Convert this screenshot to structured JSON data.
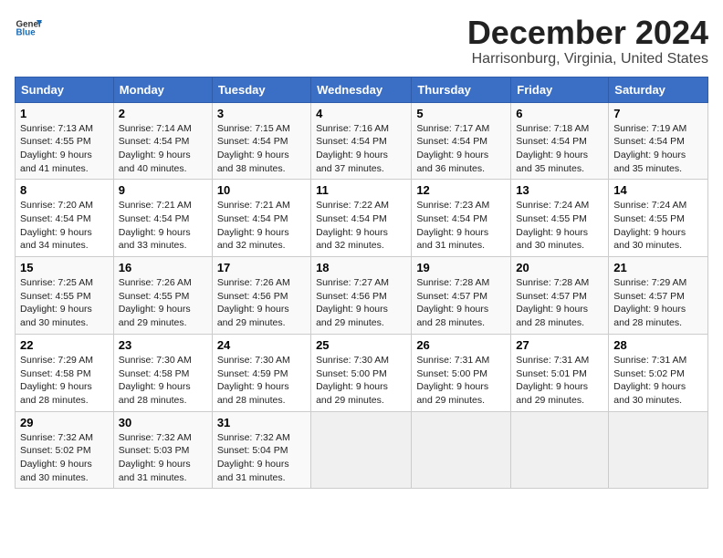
{
  "header": {
    "logo_line1": "General",
    "logo_line2": "Blue",
    "title": "December 2024",
    "subtitle": "Harrisonburg, Virginia, United States"
  },
  "columns": [
    "Sunday",
    "Monday",
    "Tuesday",
    "Wednesday",
    "Thursday",
    "Friday",
    "Saturday"
  ],
  "weeks": [
    [
      {
        "day": "1",
        "info": "Sunrise: 7:13 AM\nSunset: 4:55 PM\nDaylight: 9 hours\nand 41 minutes."
      },
      {
        "day": "2",
        "info": "Sunrise: 7:14 AM\nSunset: 4:54 PM\nDaylight: 9 hours\nand 40 minutes."
      },
      {
        "day": "3",
        "info": "Sunrise: 7:15 AM\nSunset: 4:54 PM\nDaylight: 9 hours\nand 38 minutes."
      },
      {
        "day": "4",
        "info": "Sunrise: 7:16 AM\nSunset: 4:54 PM\nDaylight: 9 hours\nand 37 minutes."
      },
      {
        "day": "5",
        "info": "Sunrise: 7:17 AM\nSunset: 4:54 PM\nDaylight: 9 hours\nand 36 minutes."
      },
      {
        "day": "6",
        "info": "Sunrise: 7:18 AM\nSunset: 4:54 PM\nDaylight: 9 hours\nand 35 minutes."
      },
      {
        "day": "7",
        "info": "Sunrise: 7:19 AM\nSunset: 4:54 PM\nDaylight: 9 hours\nand 35 minutes."
      }
    ],
    [
      {
        "day": "8",
        "info": "Sunrise: 7:20 AM\nSunset: 4:54 PM\nDaylight: 9 hours\nand 34 minutes."
      },
      {
        "day": "9",
        "info": "Sunrise: 7:21 AM\nSunset: 4:54 PM\nDaylight: 9 hours\nand 33 minutes."
      },
      {
        "day": "10",
        "info": "Sunrise: 7:21 AM\nSunset: 4:54 PM\nDaylight: 9 hours\nand 32 minutes."
      },
      {
        "day": "11",
        "info": "Sunrise: 7:22 AM\nSunset: 4:54 PM\nDaylight: 9 hours\nand 32 minutes."
      },
      {
        "day": "12",
        "info": "Sunrise: 7:23 AM\nSunset: 4:54 PM\nDaylight: 9 hours\nand 31 minutes."
      },
      {
        "day": "13",
        "info": "Sunrise: 7:24 AM\nSunset: 4:55 PM\nDaylight: 9 hours\nand 30 minutes."
      },
      {
        "day": "14",
        "info": "Sunrise: 7:24 AM\nSunset: 4:55 PM\nDaylight: 9 hours\nand 30 minutes."
      }
    ],
    [
      {
        "day": "15",
        "info": "Sunrise: 7:25 AM\nSunset: 4:55 PM\nDaylight: 9 hours\nand 30 minutes."
      },
      {
        "day": "16",
        "info": "Sunrise: 7:26 AM\nSunset: 4:55 PM\nDaylight: 9 hours\nand 29 minutes."
      },
      {
        "day": "17",
        "info": "Sunrise: 7:26 AM\nSunset: 4:56 PM\nDaylight: 9 hours\nand 29 minutes."
      },
      {
        "day": "18",
        "info": "Sunrise: 7:27 AM\nSunset: 4:56 PM\nDaylight: 9 hours\nand 29 minutes."
      },
      {
        "day": "19",
        "info": "Sunrise: 7:28 AM\nSunset: 4:57 PM\nDaylight: 9 hours\nand 28 minutes."
      },
      {
        "day": "20",
        "info": "Sunrise: 7:28 AM\nSunset: 4:57 PM\nDaylight: 9 hours\nand 28 minutes."
      },
      {
        "day": "21",
        "info": "Sunrise: 7:29 AM\nSunset: 4:57 PM\nDaylight: 9 hours\nand 28 minutes."
      }
    ],
    [
      {
        "day": "22",
        "info": "Sunrise: 7:29 AM\nSunset: 4:58 PM\nDaylight: 9 hours\nand 28 minutes."
      },
      {
        "day": "23",
        "info": "Sunrise: 7:30 AM\nSunset: 4:58 PM\nDaylight: 9 hours\nand 28 minutes."
      },
      {
        "day": "24",
        "info": "Sunrise: 7:30 AM\nSunset: 4:59 PM\nDaylight: 9 hours\nand 28 minutes."
      },
      {
        "day": "25",
        "info": "Sunrise: 7:30 AM\nSunset: 5:00 PM\nDaylight: 9 hours\nand 29 minutes."
      },
      {
        "day": "26",
        "info": "Sunrise: 7:31 AM\nSunset: 5:00 PM\nDaylight: 9 hours\nand 29 minutes."
      },
      {
        "day": "27",
        "info": "Sunrise: 7:31 AM\nSunset: 5:01 PM\nDaylight: 9 hours\nand 29 minutes."
      },
      {
        "day": "28",
        "info": "Sunrise: 7:31 AM\nSunset: 5:02 PM\nDaylight: 9 hours\nand 30 minutes."
      }
    ],
    [
      {
        "day": "29",
        "info": "Sunrise: 7:32 AM\nSunset: 5:02 PM\nDaylight: 9 hours\nand 30 minutes."
      },
      {
        "day": "30",
        "info": "Sunrise: 7:32 AM\nSunset: 5:03 PM\nDaylight: 9 hours\nand 31 minutes."
      },
      {
        "day": "31",
        "info": "Sunrise: 7:32 AM\nSunset: 5:04 PM\nDaylight: 9 hours\nand 31 minutes."
      },
      null,
      null,
      null,
      null
    ]
  ]
}
